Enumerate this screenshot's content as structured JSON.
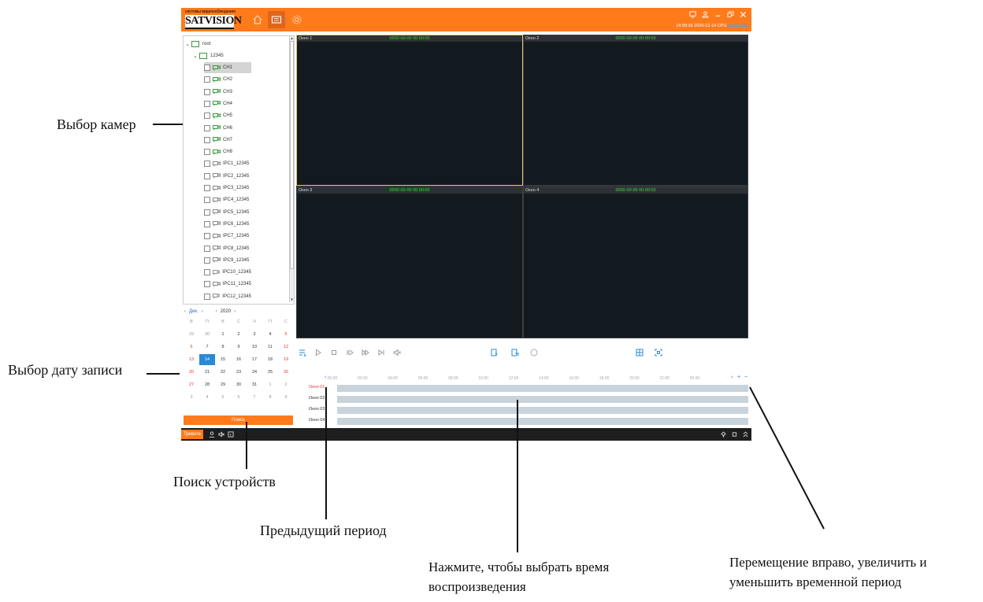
{
  "app": {
    "brand_small": "системы видеонаблюдения",
    "brand": "SATVISION",
    "clock": "14:08:30 2020-12-14 CPU"
  },
  "tree": {
    "root": "root",
    "device": "12345",
    "items": [
      "CH1",
      "CH2",
      "CH3",
      "CH4",
      "CH5",
      "CH6",
      "CH7",
      "CH8",
      "IPC1_12345",
      "IPC2_12345",
      "IPC3_12345",
      "IPC4_12345",
      "IPC5_12345",
      "IPC6_12345",
      "IPC7_12345",
      "IPC8_12345",
      "IPC9_12345",
      "IPC10_12345",
      "IPC11_12345",
      "IPC12_12345"
    ]
  },
  "calendar": {
    "month": "Дек.",
    "year": "2020",
    "weekdays": [
      "В",
      "П",
      "В",
      "С",
      "Ч",
      "П",
      "С"
    ],
    "weeks": [
      [
        "29",
        "30",
        "1",
        "2",
        "3",
        "4",
        "5"
      ],
      [
        "6",
        "7",
        "8",
        "9",
        "10",
        "11",
        "12"
      ],
      [
        "13",
        "14",
        "15",
        "16",
        "17",
        "18",
        "19"
      ],
      [
        "20",
        "21",
        "22",
        "23",
        "24",
        "25",
        "26"
      ],
      [
        "27",
        "28",
        "29",
        "30",
        "31",
        "1",
        "2"
      ],
      [
        "3",
        "4",
        "5",
        "6",
        "7",
        "8",
        "9"
      ]
    ],
    "selected": "14",
    "search_label": "Поиск"
  },
  "windows": [
    {
      "name": "Окно 1",
      "ts": "0000-00-00 00:00:00"
    },
    {
      "name": "Окно 2",
      "ts": "0000-00-00 00:00:00"
    },
    {
      "name": "Окно 3",
      "ts": "0000-00-00 00:00:00"
    },
    {
      "name": "Окно 4",
      "ts": "0000-00-00 00:00:00"
    }
  ],
  "timeline": {
    "ticks": [
      "00:00",
      "02:00",
      "04:00",
      "06:00",
      "08:00",
      "10:00",
      "12:00",
      "14:00",
      "16:00",
      "18:00",
      "20:00",
      "22:00",
      "00:00"
    ],
    "rows": [
      "Окно 01",
      "Окно 02",
      "Окно 03",
      "Окно 04"
    ],
    "prev": "‹",
    "next": "›",
    "zoom_in": "+",
    "zoom_out": "−"
  },
  "statusbar": {
    "alarm": "Тревога"
  },
  "callouts": {
    "cameras": "Выбор камер",
    "date": "Выбор дату записи",
    "search": "Поиск устройств",
    "prev": "Предыдущий период",
    "play_line1": "Нажмите, чтобы выбрать время",
    "play_line2": "воспроизведения",
    "move_line1": "Перемещение вправо, увеличить и",
    "move_line2": "уменьшить временной период"
  },
  "colors": {
    "accent": "#ff7a1a",
    "blue": "#2a8ad6",
    "video_bg": "#131a1f",
    "timestamp": "#3cdc3c"
  }
}
